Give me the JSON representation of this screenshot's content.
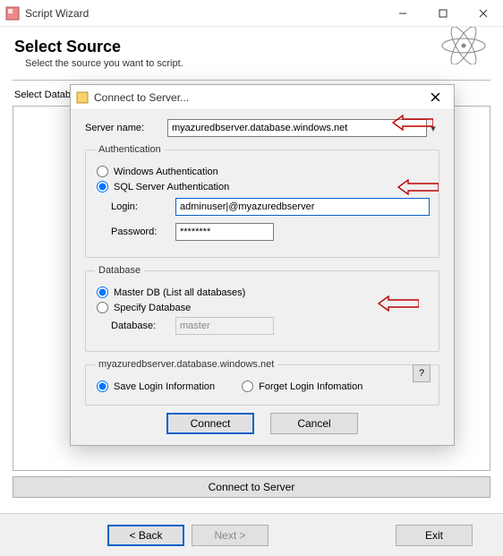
{
  "window": {
    "title": "Script Wizard"
  },
  "page": {
    "heading": "Select Source",
    "subheading": "Select the source you want to script.",
    "field_label": "Select Database:",
    "connect_button": "Connect to Server"
  },
  "footer": {
    "back": "< Back",
    "next": "Next >",
    "exit": "Exit"
  },
  "dialog": {
    "title": "Connect to Server...",
    "server_label": "Server name:",
    "server_value": "myazuredbserver.database.windows.net",
    "auth": {
      "legend": "Authentication",
      "windows": "Windows Authentication",
      "sql": "SQL Server Authentication",
      "login_label": "Login:",
      "login_value": "adminuser|@myazuredbserver",
      "password_label": "Password:",
      "password_value": "********"
    },
    "db": {
      "legend": "Database",
      "master": "Master DB (List all databases)",
      "specify": "Specify Database",
      "db_label": "Database:",
      "db_value": "master",
      "help": "?"
    },
    "save": {
      "legend": "myazuredbserver.database.windows.net",
      "save_login": "Save Login Information",
      "forget_login": "Forget Login Infomation"
    },
    "buttons": {
      "connect": "Connect",
      "cancel": "Cancel"
    }
  }
}
